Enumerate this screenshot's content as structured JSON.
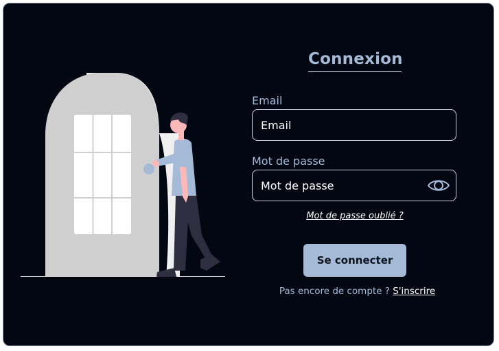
{
  "login": {
    "title": "Connexion",
    "email_label": "Email",
    "email_placeholder": "Email",
    "password_label": "Mot de passe",
    "password_placeholder": "Mot de passe",
    "forgot_link": "Mot de passe oublié ?",
    "submit_label": "Se connecter",
    "signup_prompt": "Pas encore de compte ?",
    "signup_link": "S'inscrire",
    "password_toggle_icon": "eye-icon"
  },
  "illustration": {
    "icon": "person-opening-door-illustration"
  },
  "colors": {
    "background": "#030712",
    "accent": "#a4bad6",
    "border": "#c7d4e6",
    "text": "#ffffff"
  }
}
